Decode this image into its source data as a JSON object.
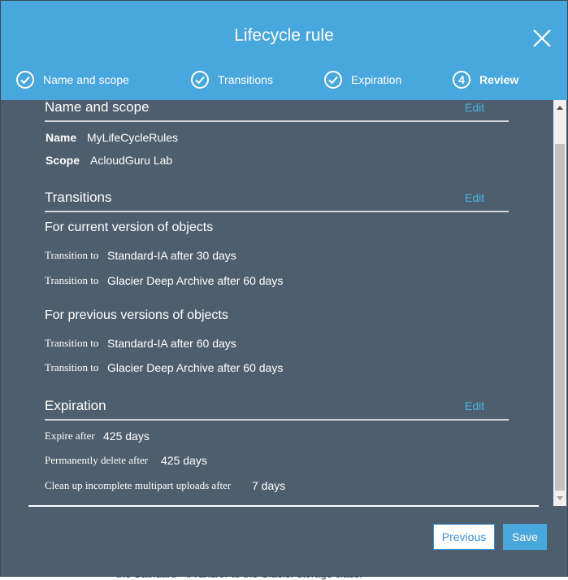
{
  "modal": {
    "title": "Lifecycle rule"
  },
  "steps": [
    {
      "label": "Name and scope",
      "state": "done",
      "icon": "check-icon"
    },
    {
      "label": "Transitions",
      "state": "done",
      "icon": "check-icon"
    },
    {
      "label": "Expiration",
      "state": "done",
      "icon": "check-icon"
    },
    {
      "label": "Review",
      "state": "active",
      "number": "4"
    }
  ],
  "review": {
    "name_scope": {
      "title": "Name and scope",
      "edit": "Edit",
      "name_label": "Name",
      "name_value": "MyLifeCycleRules",
      "scope_label": "Scope",
      "scope_value": "AcloudGuru Lab"
    },
    "transitions": {
      "title": "Transitions",
      "edit": "Edit",
      "current_title": "For current version of objects",
      "current": [
        {
          "label": "Transition to",
          "value": "Standard-IA after 30 days"
        },
        {
          "label": "Transition to",
          "value": "Glacier Deep Archive after 60 days"
        }
      ],
      "previous_title": "For previous versions of objects",
      "previous": [
        {
          "label": "Transition to",
          "value": "Standard-IA after 60 days"
        },
        {
          "label": "Transition to",
          "value": "Glacier Deep Archive after 60 days"
        }
      ]
    },
    "expiration": {
      "title": "Expiration",
      "edit": "Edit",
      "rows": [
        {
          "label": "Expire after",
          "value": "425 days"
        },
        {
          "label": "Permanently delete after",
          "value": "425 days"
        },
        {
          "label": "Clean up incomplete multipart uploads after",
          "value": "7 days"
        }
      ]
    }
  },
  "footer": {
    "previous": "Previous",
    "save": "Save"
  },
  "backdrop": {
    "partial_text": "the Standard - IA and/or to the Glacier storage class."
  },
  "colors": {
    "header": "#48a7dc",
    "body": "#4d5f6e",
    "link": "#48b4e6"
  }
}
